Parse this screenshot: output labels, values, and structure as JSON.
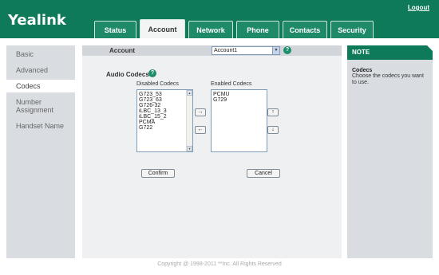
{
  "header": {
    "logo": "Yealink",
    "logout": "Logout",
    "tabs": [
      "Status",
      "Account",
      "Network",
      "Phone",
      "Contacts",
      "Security"
    ],
    "active_tab": "Account"
  },
  "sidebar": {
    "items": [
      "Basic",
      "Advanced",
      "Codecs",
      "Number Assignment",
      "Handset Name"
    ],
    "active_item": "Codecs"
  },
  "account": {
    "label": "Account",
    "selected": "Account1",
    "help": "?"
  },
  "codecs": {
    "title": "Audio Codecs",
    "help": "?",
    "disabled_label": "Disabled Codecs",
    "enabled_label": "Enabled Codecs",
    "disabled": [
      "G723_53",
      "G723_63",
      "G726-32",
      "iLBC_13_3",
      "iLBC_15_2",
      "PCMA",
      "G722"
    ],
    "enabled": [
      "PCMU",
      "G729"
    ],
    "move_right": "→",
    "move_left": "←",
    "move_up": "↑",
    "move_down": "↓",
    "confirm": "Confirm",
    "cancel": "Cancel"
  },
  "note": {
    "header": "NOTE",
    "title": "Codecs",
    "text": "Choose the codecs you want to use."
  },
  "footer": {
    "copyright": "Copyright @ 1998-2011 **Inc. All Rights Reserved"
  },
  "colors": {
    "brand_green": "#0e7a59",
    "panel_gray": "#d9dde2",
    "main_bg": "#eef0f2"
  }
}
